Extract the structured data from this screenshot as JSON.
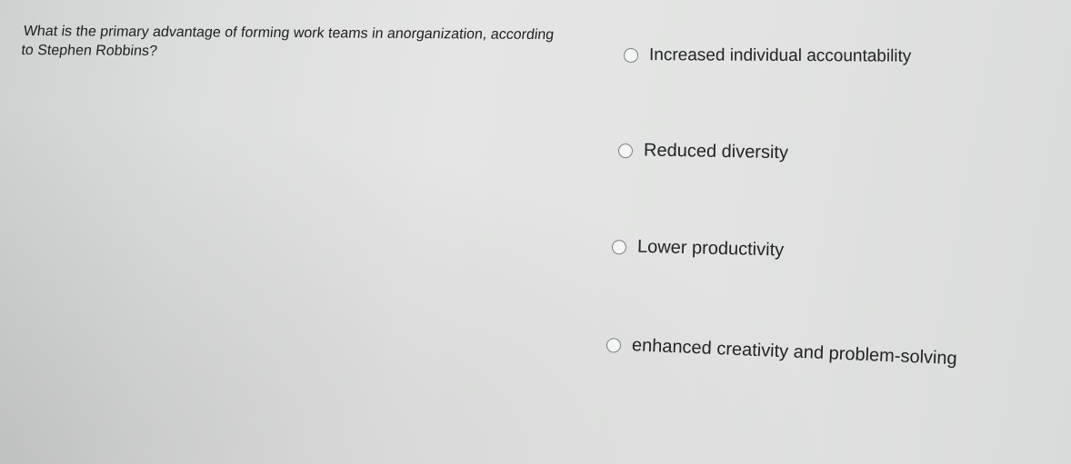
{
  "question": {
    "text": "What is the primary advantage of forming work teams in anorganization, according to Stephen Robbins?"
  },
  "options": [
    {
      "label": "Increased individual accountability",
      "selected": false
    },
    {
      "label": "Reduced diversity",
      "selected": false
    },
    {
      "label": "Lower productivity",
      "selected": false
    },
    {
      "label": "enhanced creativity and problem-solving",
      "selected": false
    }
  ],
  "colors": {
    "radio_border": "#7b7f84",
    "text": "#222327",
    "background": "#e2e3e2"
  },
  "icons": {
    "radio": "radio-button-unchecked-icon"
  }
}
